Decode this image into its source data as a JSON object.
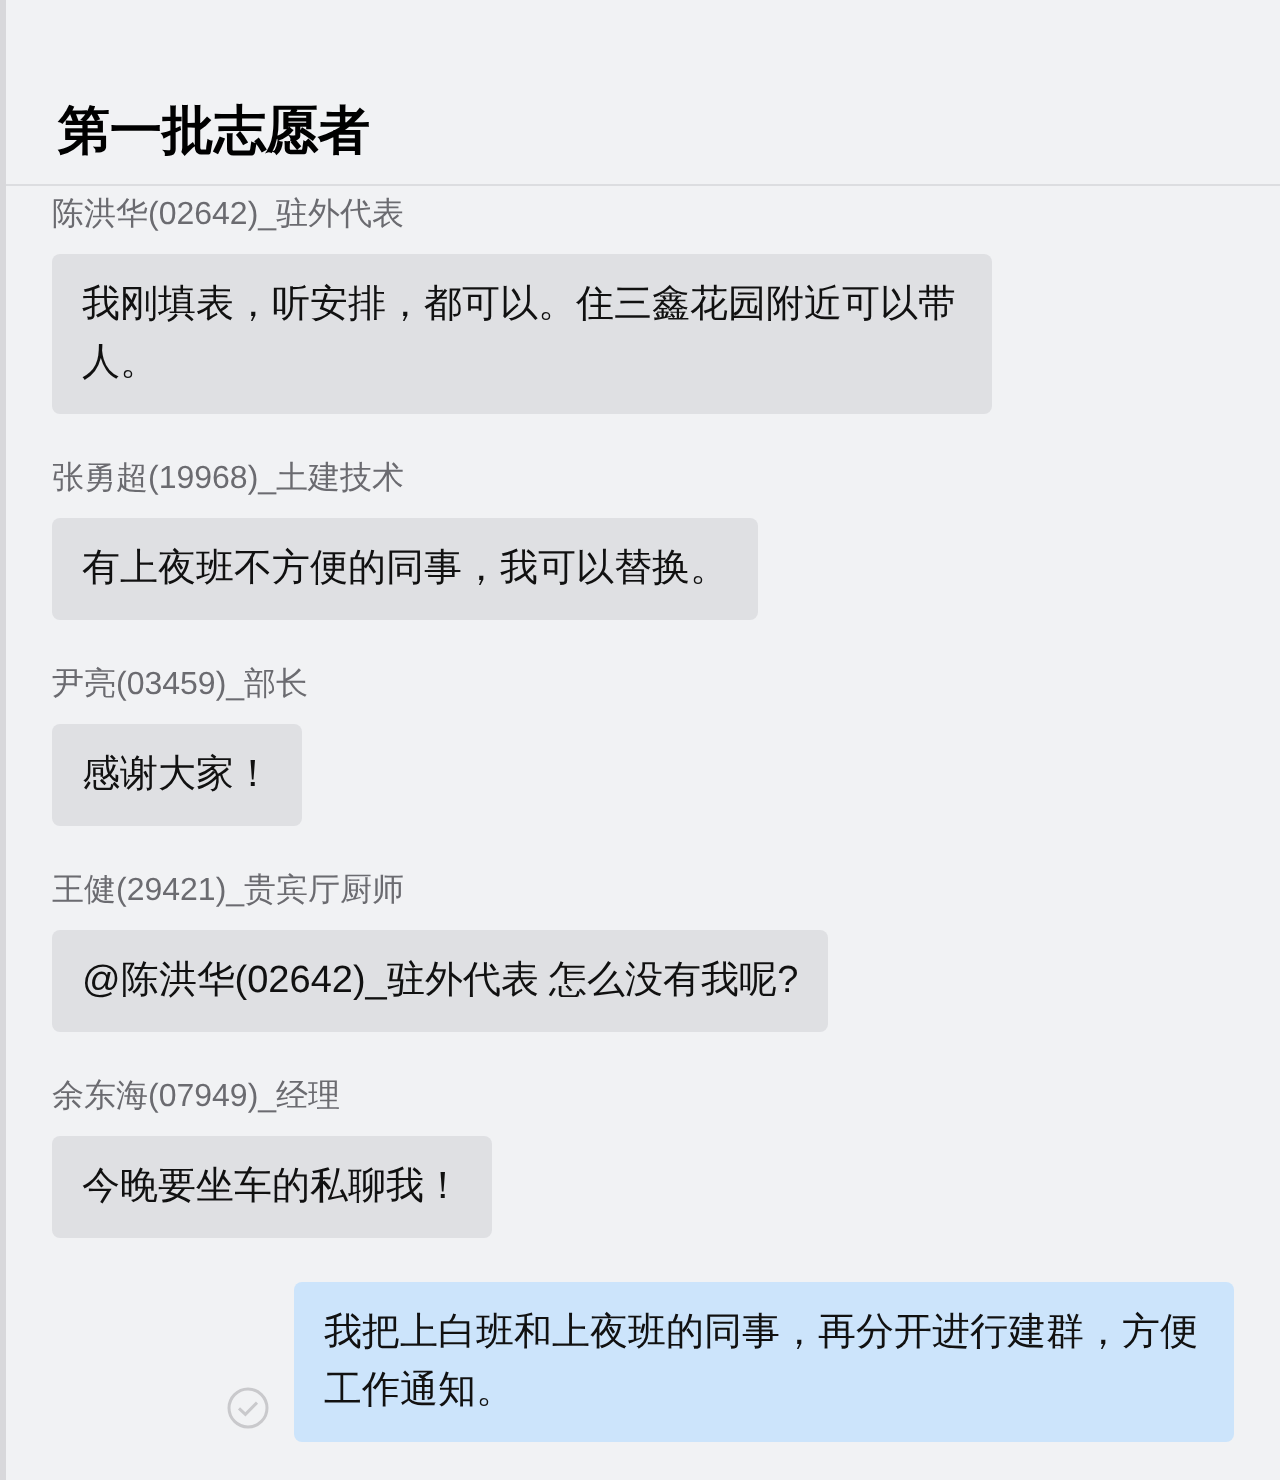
{
  "header": {
    "title": "第一批志愿者"
  },
  "messages": [
    {
      "kind": "received",
      "sender": "陈洪华(02642)_驻外代表",
      "text": "我刚填表，听安排，都可以。住三鑫花园附近可以带人。"
    },
    {
      "kind": "received",
      "sender": "张勇超(19968)_土建技术",
      "text": "有上夜班不方便的同事，我可以替换。"
    },
    {
      "kind": "received",
      "sender": "尹亮(03459)_部长",
      "text": "感谢大家！"
    },
    {
      "kind": "received",
      "sender": "王健(29421)_贵宾厅厨师",
      "text": "@陈洪华(02642)_驻外代表 怎么没有我呢?"
    },
    {
      "kind": "received",
      "sender": "余东海(07949)_经理",
      "text": "今晚要坐车的私聊我！"
    },
    {
      "kind": "sent",
      "text": "我把上白班和上夜班的同事，再分开进行建群，方便工作通知。"
    }
  ]
}
